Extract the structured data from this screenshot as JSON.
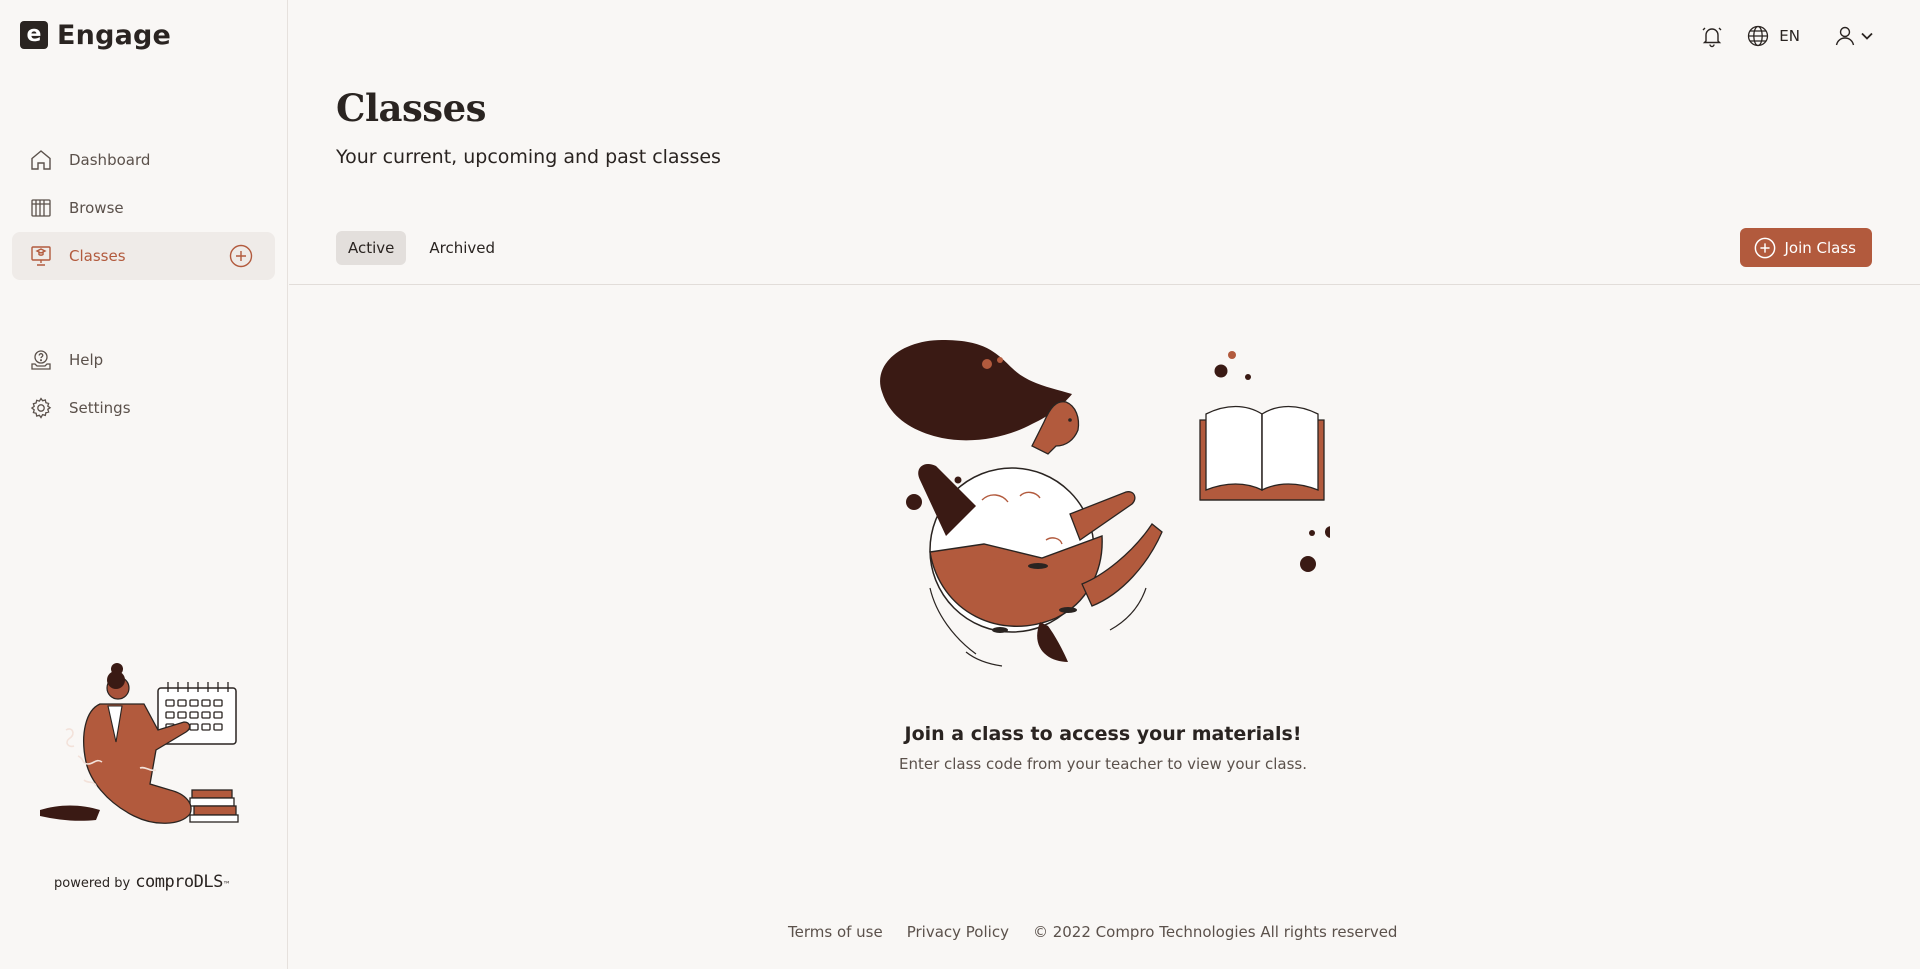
{
  "brand": {
    "logo_letter": "e",
    "name": "Engage"
  },
  "sidebar": {
    "items": [
      {
        "label": "Dashboard",
        "icon": "home-icon"
      },
      {
        "label": "Browse",
        "icon": "books-icon"
      },
      {
        "label": "Classes",
        "icon": "classroom-icon",
        "active": true
      }
    ],
    "bottom_items": [
      {
        "label": "Help",
        "icon": "help-icon"
      },
      {
        "label": "Settings",
        "icon": "gear-icon"
      }
    ],
    "powered_by": "powered by",
    "powered_brand": "comproDLS",
    "powered_tm": "™"
  },
  "topbar": {
    "language": "EN"
  },
  "page": {
    "title": "Classes",
    "subtitle": "Your current, upcoming and past classes",
    "tabs": [
      "Active",
      "Archived"
    ],
    "join_button": "Join Class"
  },
  "empty_state": {
    "title": "Join a class to access your materials!",
    "subtitle": "Enter class code from your teacher to view your class."
  },
  "footer": {
    "terms": "Terms of use",
    "privacy": "Privacy Policy",
    "copyright": "© 2022 Compro Technologies All rights reserved"
  },
  "colors": {
    "accent": "#b25a3d",
    "dark": "#2a2421",
    "background": "#f9f7f5",
    "hair": "#3a1a14"
  }
}
